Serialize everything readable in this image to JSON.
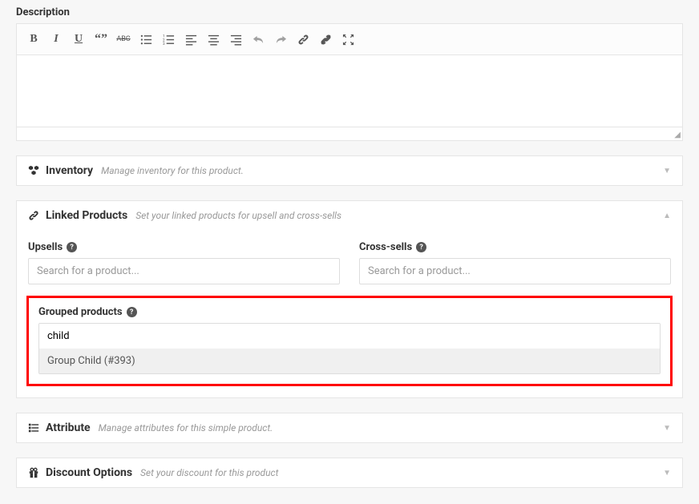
{
  "description": {
    "label": "Description"
  },
  "inventory": {
    "title": "Inventory",
    "subtitle": "Manage inventory for this product."
  },
  "linked": {
    "title": "Linked Products",
    "subtitle": "Set your linked products for upsell and cross-sells",
    "upsells": {
      "label": "Upsells",
      "placeholder": "Search for a product..."
    },
    "crosssells": {
      "label": "Cross-sells",
      "placeholder": "Search for a product..."
    },
    "grouped": {
      "label": "Grouped products",
      "value": "child",
      "option": "Group Child (#393)"
    }
  },
  "attribute": {
    "title": "Attribute",
    "subtitle": "Manage attributes for this simple product."
  },
  "discount": {
    "title": "Discount Options",
    "subtitle": "Set your discount for this product"
  },
  "help": "?"
}
